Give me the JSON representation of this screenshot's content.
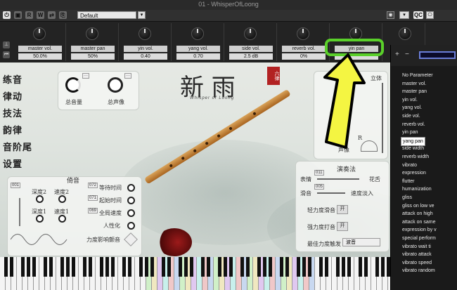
{
  "window": {
    "title": "01 - WhisperOfLoong",
    "preset": "Default"
  },
  "toolbar": {
    "btn_r": "R",
    "btn_w": "W",
    "btn_qc": "QC"
  },
  "params": [
    {
      "label": "master vol.",
      "value": "50.0%"
    },
    {
      "label": "master pan",
      "value": "50%"
    },
    {
      "label": "yin vol.",
      "value": "0.40"
    },
    {
      "label": "yang vol.",
      "value": "0.70"
    },
    {
      "label": "side vol.",
      "value": "2.5 dB"
    },
    {
      "label": "reverb vol.",
      "value": "0%"
    },
    {
      "label": "yin pan",
      "value": ""
    }
  ],
  "instrument": {
    "title": "新 雨",
    "seal": "六律",
    "subtitle": "Whisper of Loong",
    "menu": [
      "练音",
      "律动",
      "技法",
      "韵律",
      "音阶尾",
      "设置"
    ],
    "vol_panel": {
      "label_volume": "总音量",
      "label_pan": "总声像"
    },
    "right_top": {
      "header": "立体",
      "pan_label": "声像",
      "r_label": "R"
    },
    "ornament": {
      "header": "倚音",
      "tag_a": "001",
      "tag_b": "072",
      "tag_c": "071",
      "tag_d": "069",
      "depth2": "深度2",
      "speed2": "速度2",
      "depth1": "深度1",
      "speed1": "速度1",
      "rows": [
        "等待时间",
        "起始时间",
        "全局速度",
        "人性化"
      ],
      "force_label": "力度影响颤音"
    },
    "perform": {
      "header": "演奏法",
      "tag1": "011",
      "tag2": "005",
      "row1": "表情",
      "row1_right": "花舌",
      "row2": "滑音",
      "row2_right": "速度淡入",
      "row3": "轻力度滑音",
      "row4": "强力度打音",
      "row5": "最佳力度触发",
      "toggle": "开",
      "select": "波音"
    }
  },
  "param_list": {
    "add_btn": "+",
    "remove_btn": "−",
    "selected": "yang pan",
    "items": [
      "No Parameter",
      "master vol.",
      "master pan",
      "yin vol.",
      "yang vol.",
      "side vol.",
      "reverb vol.",
      "yin pan",
      "yang pan",
      "side width",
      "reverb width",
      "vibrato",
      "expression",
      "flutter",
      "humanization",
      "gliss",
      "gliss on low ve",
      "attack on high",
      "attack on same",
      "expression by v",
      "special perform",
      "vibrato wait ti",
      "vibrato attack",
      "vibrato speed",
      "vibrato random"
    ]
  },
  "colors": {
    "highlight": "#5ad02a",
    "arrow": "#f4f542",
    "search_border": "#6a7dd8"
  }
}
